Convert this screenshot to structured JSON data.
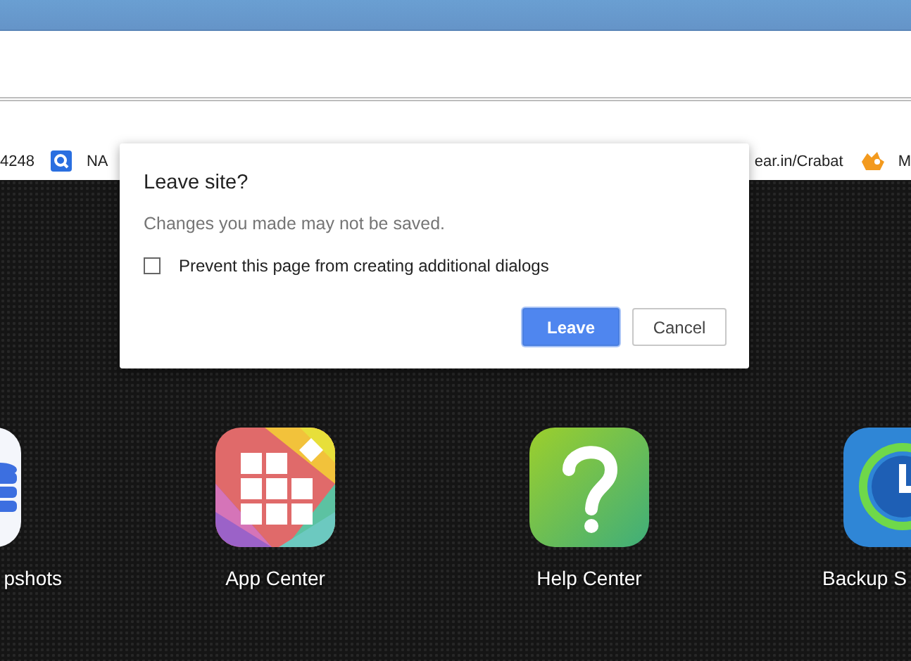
{
  "bookmarks": {
    "left": [
      {
        "label": "4248",
        "kind": "plain"
      },
      {
        "label": "NA",
        "kind": "tile"
      }
    ],
    "right": [
      {
        "label": "ear.in/Crabat",
        "kind": "plain"
      },
      {
        "label": "M",
        "kind": "sprite"
      }
    ]
  },
  "apps": [
    {
      "label": "pshots",
      "kind": "snapshot"
    },
    {
      "label": "App Center",
      "kind": "app-center"
    },
    {
      "label": "Help Center",
      "kind": "help-center"
    },
    {
      "label": "Backup S",
      "kind": "backup"
    }
  ],
  "dialog": {
    "title": "Leave site?",
    "message": "Changes you made may not be saved.",
    "checkbox": {
      "label": "Prevent this page from creating additional dialogs",
      "checked": false
    },
    "buttons": [
      {
        "label": "Leave",
        "kind": "primary"
      },
      {
        "label": "Cancel",
        "kind": "secondary"
      }
    ]
  }
}
